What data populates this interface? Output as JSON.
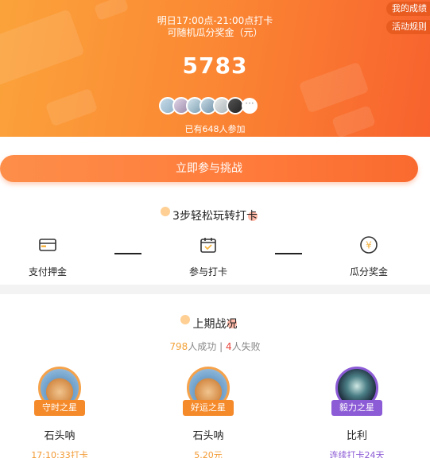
{
  "banner": {
    "line1": "明日17:00点-21:00点打卡",
    "line2": "可随机瓜分奖金（元）",
    "amount": "5783",
    "joined": "已有648人参加",
    "more_icon": "ellipsis-icon",
    "my_results": "我的成绩",
    "rules": "活动规则"
  },
  "join_button": "立即参与挑战",
  "steps": {
    "title": "3步轻松玩转打卡",
    "items": [
      {
        "label": "支付押金",
        "icon": "card-icon"
      },
      {
        "label": "参与打卡",
        "icon": "calendar-check-icon"
      },
      {
        "label": "瓜分奖金",
        "icon": "yen-coin-icon"
      }
    ]
  },
  "last_period": {
    "title": "上期战况",
    "success_count": "798",
    "success_label": "人成功 | ",
    "fail_count": "4",
    "fail_label": "人失败",
    "winners": [
      {
        "badge": "守时之星",
        "name": "石头呐",
        "detail": "17:10:33打卡",
        "color": "#f58a2a"
      },
      {
        "badge": "好运之星",
        "name": "石头呐",
        "detail": "5.20元",
        "color": "#f58a2a"
      },
      {
        "badge": "毅力之星",
        "name": "比利",
        "detail": "连续打卡24天",
        "color": "#8c5bd6"
      }
    ]
  }
}
